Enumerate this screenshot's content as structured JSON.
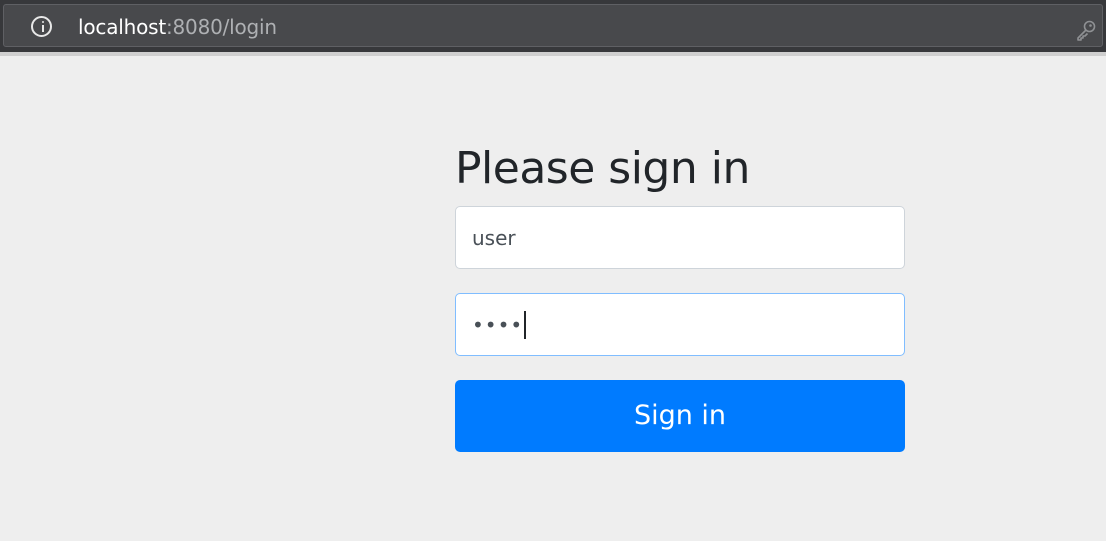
{
  "browser": {
    "url_host": "localhost",
    "url_rest": ":8080/login",
    "icons": {
      "site_info": "info-icon",
      "password_manager": "key-icon"
    }
  },
  "login_form": {
    "heading": "Please sign in",
    "username": {
      "value": "user"
    },
    "password": {
      "masked_value": "••••",
      "focused": true
    },
    "submit_label": "Sign in"
  },
  "colors": {
    "page_background": "#eeeeee",
    "browser_bar": "#37383b",
    "address_bar": "#48494c",
    "primary_button": "#007bff",
    "heading_text": "#212529",
    "input_text": "#495057",
    "focus_border": "#80bdff"
  }
}
